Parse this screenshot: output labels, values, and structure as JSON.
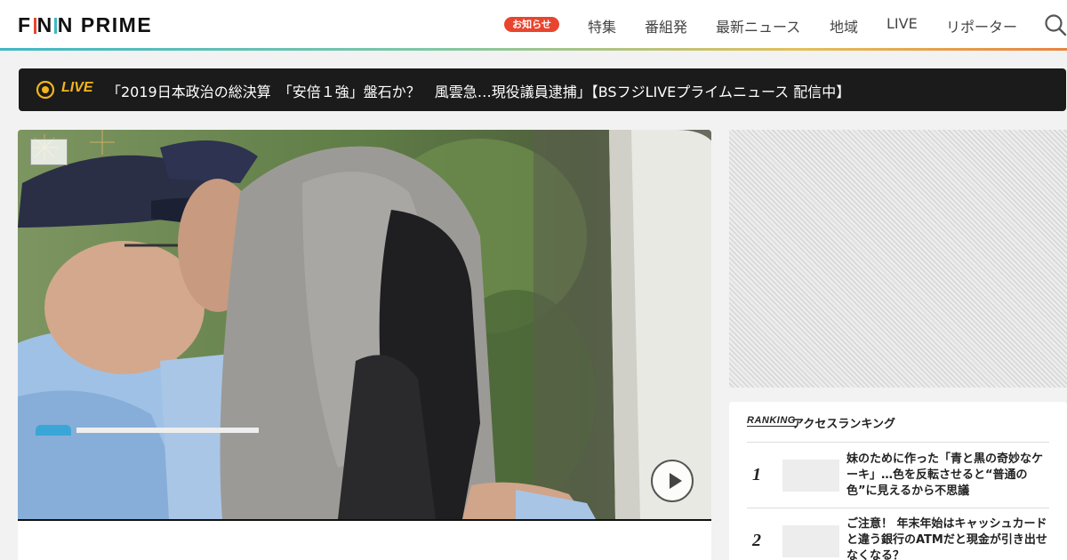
{
  "header": {
    "logo": {
      "part1": "F",
      "part2": "N",
      "part3": "N",
      "part4": "PRIME"
    },
    "notice_badge": "お知らせ",
    "nav": [
      "特集",
      "番組発",
      "最新ニュース",
      "地域",
      "LIVE",
      "リポーター"
    ],
    "search_icon": "search-icon"
  },
  "live": {
    "label": "LIVE",
    "text": "「2019日本政治の総決算　「安倍１強」盤石か？　風雲急…現役議員逮捕」【BSフジLIVEプライムニュース 配信中】"
  },
  "ranking": {
    "label_en": "RANKING",
    "title": "アクセスランキング",
    "items": [
      {
        "rank": "1",
        "title": "妹のために作った「青と黒の奇妙なケーキ」…色を反転させると“普通の色”に見えるから不思議"
      },
      {
        "rank": "2",
        "title": "ご注意！ 年末年始はキャッシュカードと違う銀行のATMだと現金が引き出せなくなる？"
      }
    ]
  },
  "colors": {
    "accent_live": "#f2b51d",
    "notice": "#e8452f",
    "header_bar_start": "#3fb8c4",
    "header_bar_end": "#e8833f"
  }
}
